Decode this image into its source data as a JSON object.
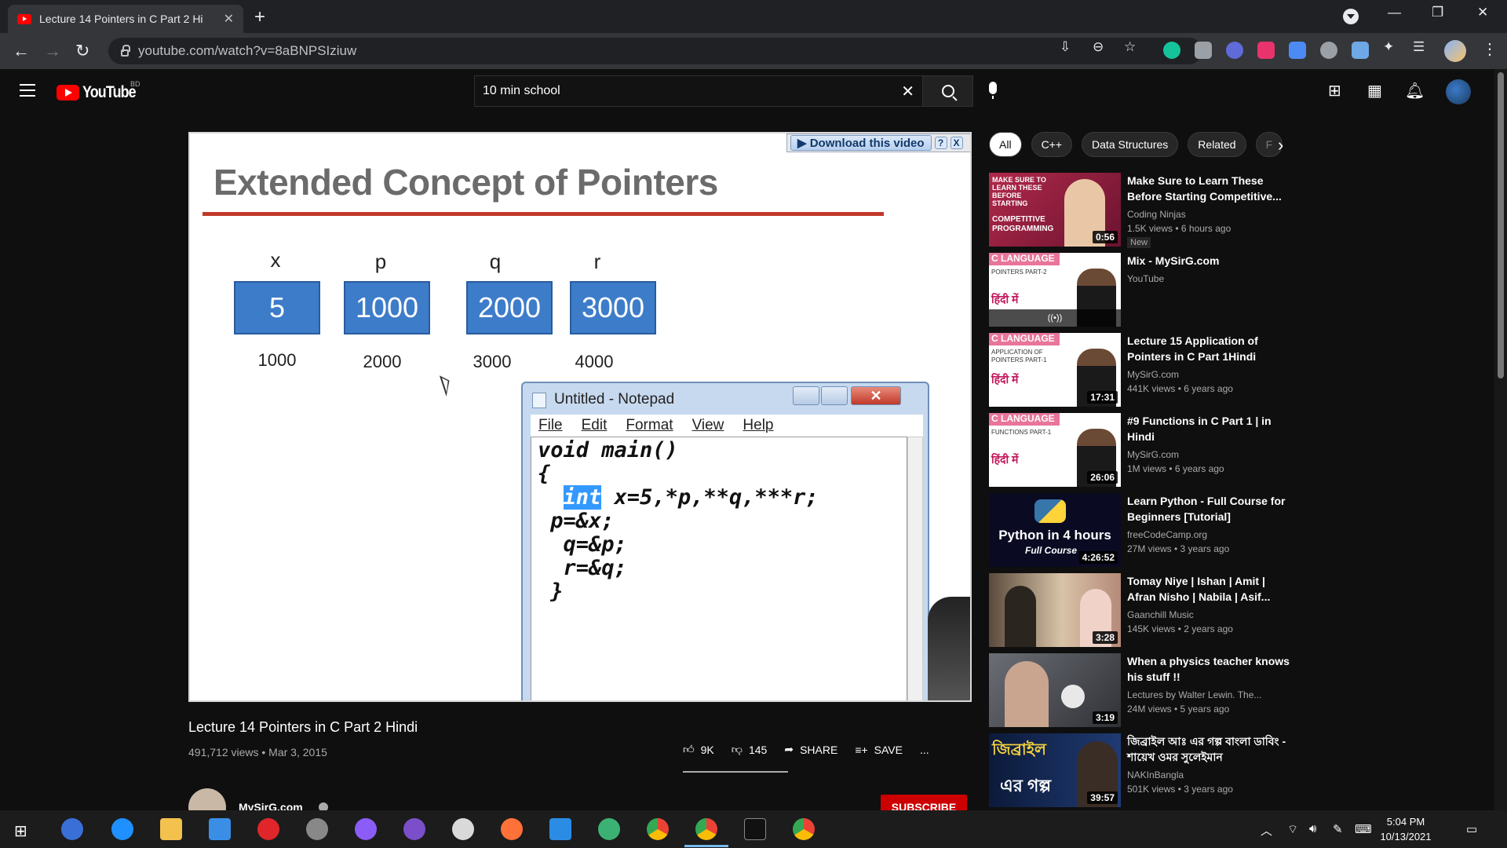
{
  "browser": {
    "tab_title": "Lecture 14 Pointers in C Part 2 Hi",
    "url": "youtube.com/watch?v=8aBNPSIziuw"
  },
  "youtube": {
    "logo_text": "YouTube",
    "region": "BD",
    "search_value": "10 min school"
  },
  "player": {
    "download_label": "▶ Download this video",
    "help_label": "?",
    "close_label": "X",
    "slide_title": "Extended Concept of Pointers",
    "vars": [
      {
        "name": "x",
        "value": "5",
        "address": "1000"
      },
      {
        "name": "p",
        "value": "1000",
        "address": "2000"
      },
      {
        "name": "q",
        "value": "2000",
        "address": "3000"
      },
      {
        "name": "r",
        "value": "3000",
        "address": "4000"
      }
    ],
    "notepad": {
      "title": "Untitled - Notepad",
      "menu": [
        "File",
        "Edit",
        "Format",
        "View",
        "Help"
      ],
      "code_line1": "void main()",
      "code_line2": "{",
      "code_highlight": "int",
      "code_line3_rest": " x=5,*p,**q,***r;",
      "code_line4": " p=&x;",
      "code_line5": "  q=&p;",
      "code_line6": "  r=&q;",
      "code_line7": " }"
    }
  },
  "video": {
    "title": "Lecture 14 Pointers in C Part 2 Hindi",
    "meta": "491,712 views • Mar 3, 2015",
    "likes": "9K",
    "dislikes": "145",
    "share": "SHARE",
    "save": "SAVE",
    "more": "...",
    "channel": "MySirG.com",
    "subscribe": "SUBSCRIBE"
  },
  "chips": [
    "All",
    "C++",
    "Data Structures",
    "Related",
    "F"
  ],
  "recommendations": [
    {
      "title": "Make Sure to Learn These Before Starting Competitive...",
      "channel": "Coding Ninjas",
      "views": "1.5K views • 6 hours ago",
      "badge": "New",
      "duration": "0:56",
      "thumb_text": "MAKE SURE TO LEARN THESE BEFORE STARTING",
      "thumb_text2": "COMPETITIVE PROGRAMMING"
    },
    {
      "title": "Mix - MySirG.com",
      "channel": "YouTube",
      "views": "",
      "duration": "",
      "clang": "C LANGUAGE",
      "sub": "POINTERS PART-2",
      "hindi": "हिंदी में"
    },
    {
      "title": "Lecture 15 Application of Pointers in C Part 1Hindi",
      "channel": "MySirG.com",
      "views": "441K views • 6 years ago",
      "duration": "17:31",
      "clang": "C LANGUAGE",
      "sub": "APPLICATION OF POINTERS PART-1",
      "hindi": "हिंदी में"
    },
    {
      "title": "#9 Functions in C Part 1 | in Hindi",
      "channel": "MySirG.com",
      "views": "1M views • 6 years ago",
      "duration": "26:06",
      "clang": "C LANGUAGE",
      "sub": "FUNCTIONS PART-1",
      "hindi": "हिंदी में"
    },
    {
      "title": "Learn Python - Full Course for Beginners [Tutorial]",
      "channel": "freeCodeCamp.org",
      "views": "27M views • 3 years ago",
      "duration": "4:26:52",
      "thumb_text": "Python in 4 hours",
      "thumb_text2": "Full Course"
    },
    {
      "title": "Tomay Niye | Ishan | Amit | Afran Nisho | Nabila | Asif...",
      "channel": "Gaanchill Music",
      "views": "145K views • 2 years ago",
      "duration": "3:28"
    },
    {
      "title": "When a physics teacher knows his stuff !!",
      "channel": "Lectures by Walter Lewin. The...",
      "views": "24M views • 5 years ago",
      "duration": "3:19"
    },
    {
      "title": "জিব্রাইল আঃ এর গল্প বাংলা ডাবিং - শায়েখ ওমর সুলেইমান",
      "channel": "NAKInBangla",
      "views": "501K views • 3 years ago",
      "duration": "39:57",
      "thumb_text": "জিব্রাইল",
      "thumb_text2": "এর গল্প"
    }
  ],
  "taskbar": {
    "time": "5:04 PM",
    "date": "10/13/2021"
  },
  "colors": {
    "youtube_red": "#ff0000",
    "slide_box": "#3d7cc9",
    "slide_underline": "#c0392b"
  }
}
